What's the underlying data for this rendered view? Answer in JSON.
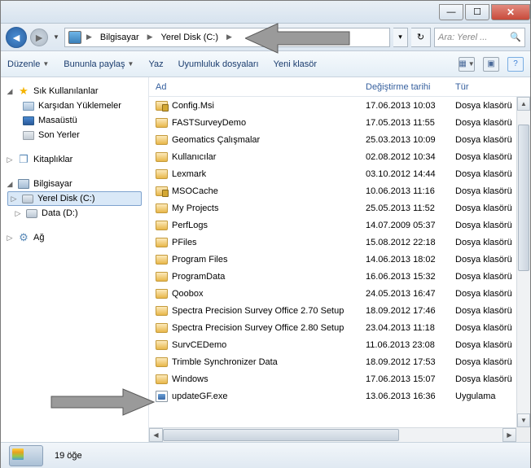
{
  "breadcrumbs": [
    "Bilgisayar",
    "Yerel Disk (C:)"
  ],
  "search": {
    "placeholder": "Ara: Yerel ..."
  },
  "toolbar": {
    "organize": "Düzenle",
    "share": "Bununla paylaş",
    "burn": "Yaz",
    "compat": "Uyumluluk dosyaları",
    "newfolder": "Yeni klasör"
  },
  "sidebar": {
    "favorites": "Sık Kullanılanlar",
    "downloads": "Karşıdan Yüklemeler",
    "desktop": "Masaüstü",
    "recent": "Son Yerler",
    "libraries": "Kitaplıklar",
    "computer": "Bilgisayar",
    "drive_c": "Yerel Disk (C:)",
    "drive_d": "Data (D:)",
    "network": "Ağ"
  },
  "columns": {
    "name": "Ad",
    "date": "Değiştirme tarihi",
    "type": "Tür"
  },
  "type_folder": "Dosya klasörü",
  "type_app": "Uygulama",
  "files": [
    {
      "name": "Config.Msi",
      "date": "17.06.2013 10:03",
      "type": "Dosya klasörü",
      "icon": "folder-lock"
    },
    {
      "name": "FASTSurveyDemo",
      "date": "17.05.2013 11:55",
      "type": "Dosya klasörü",
      "icon": "folder"
    },
    {
      "name": "Geomatics Çalışmalar",
      "date": "25.03.2013 10:09",
      "type": "Dosya klasörü",
      "icon": "folder"
    },
    {
      "name": "Kullanıcılar",
      "date": "02.08.2012 10:34",
      "type": "Dosya klasörü",
      "icon": "folder"
    },
    {
      "name": "Lexmark",
      "date": "03.10.2012 14:44",
      "type": "Dosya klasörü",
      "icon": "folder"
    },
    {
      "name": "MSOCache",
      "date": "10.06.2013 11:16",
      "type": "Dosya klasörü",
      "icon": "folder-lock"
    },
    {
      "name": "My Projects",
      "date": "25.05.2013 11:52",
      "type": "Dosya klasörü",
      "icon": "folder"
    },
    {
      "name": "PerfLogs",
      "date": "14.07.2009 05:37",
      "type": "Dosya klasörü",
      "icon": "folder"
    },
    {
      "name": "PFiles",
      "date": "15.08.2012 22:18",
      "type": "Dosya klasörü",
      "icon": "folder"
    },
    {
      "name": "Program Files",
      "date": "14.06.2013 18:02",
      "type": "Dosya klasörü",
      "icon": "folder"
    },
    {
      "name": "ProgramData",
      "date": "16.06.2013 15:32",
      "type": "Dosya klasörü",
      "icon": "folder"
    },
    {
      "name": "Qoobox",
      "date": "24.05.2013 16:47",
      "type": "Dosya klasörü",
      "icon": "folder"
    },
    {
      "name": "Spectra Precision Survey Office 2.70 Setup",
      "date": "18.09.2012 17:46",
      "type": "Dosya klasörü",
      "icon": "folder"
    },
    {
      "name": "Spectra Precision Survey Office 2.80 Setup",
      "date": "23.04.2013 11:18",
      "type": "Dosya klasörü",
      "icon": "folder"
    },
    {
      "name": "SurvCEDemo",
      "date": "11.06.2013 23:08",
      "type": "Dosya klasörü",
      "icon": "folder"
    },
    {
      "name": "Trimble Synchronizer Data",
      "date": "18.09.2012 17:53",
      "type": "Dosya klasörü",
      "icon": "folder"
    },
    {
      "name": "Windows",
      "date": "17.06.2013 15:07",
      "type": "Dosya klasörü",
      "icon": "folder"
    },
    {
      "name": "updateGF.exe",
      "date": "13.06.2013 16:36",
      "type": "Uygulama",
      "icon": "exe"
    }
  ],
  "status": {
    "count": "19 öğe"
  }
}
